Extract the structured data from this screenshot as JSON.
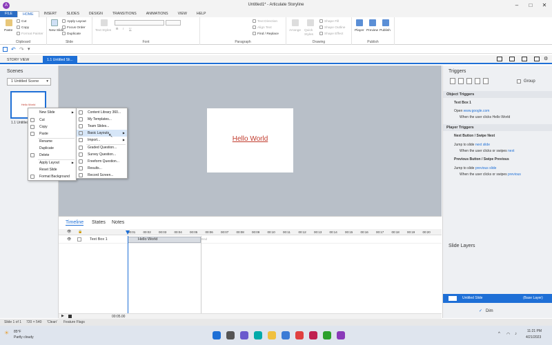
{
  "window": {
    "title": "Untitled1* - Articulate Storyline",
    "app_icon": "A"
  },
  "ribbon_tabs": [
    "FILE",
    "HOME",
    "INSERT",
    "SLIDES",
    "DESIGN",
    "TRANSITIONS",
    "ANIMATIONS",
    "VIEW",
    "HELP"
  ],
  "ribbon": {
    "clipboard": {
      "paste": "Paste",
      "cut": "Cut",
      "copy": "Copy",
      "format_painter": "Format Painter",
      "label": "Clipboard"
    },
    "slide": {
      "new_slide": "New Slide",
      "apply_layout": "Apply Layout",
      "focus_order": "Focus Order",
      "duplicate": "Duplicate",
      "label": "Slide"
    },
    "font": {
      "text_styles": "Text Styles",
      "label": "Font"
    },
    "paragraph": {
      "text_direction": "Text Direction",
      "align_text": "Align Text",
      "find_replace": "Find / Replace",
      "label": "Paragraph"
    },
    "drawing": {
      "arrange": "Arrange",
      "quick_styles": "Quick Styles",
      "shape_fill": "Shape Fill",
      "shape_outline": "Shape Outline",
      "shape_effect": "Shape Effect",
      "label": "Drawing"
    },
    "publish": {
      "player": "Player",
      "preview": "Preview",
      "publish": "Publish",
      "label": "Publish"
    }
  },
  "view_tabs": {
    "story_view": "STORY VIEW",
    "slide_tab": "1.1 Untitled Sli..."
  },
  "scenes": {
    "title": "Scenes",
    "dropdown": "1 Untitled Scene",
    "thumb_text": "Hello World",
    "thumb_label": "1.1 Untitled"
  },
  "slide": {
    "text": "Hello World"
  },
  "context_menu": {
    "items": [
      "New Slide",
      "Cut",
      "Copy",
      "Paste",
      "Rename",
      "Duplicate",
      "Delete",
      "Apply Layout",
      "Reset Slide",
      "Format Background"
    ]
  },
  "submenu": {
    "items": [
      "Content Library 360...",
      "My Templates...",
      "Team Slides...",
      "Basic Layouts",
      "Import...",
      "Graded Question...",
      "Survey Question...",
      "Freeform Question...",
      "Results...",
      "Record Screen..."
    ]
  },
  "timeline": {
    "tabs": [
      "Timeline",
      "States",
      "Notes"
    ],
    "ticks": [
      "00:01",
      "00:02",
      "00:03",
      "00:04",
      "00:05",
      "00:06",
      "00:07",
      "00:08",
      "00:09",
      "00:10",
      "00:11",
      "00:12",
      "00:13",
      "00:14",
      "00:15",
      "00:16",
      "00:17",
      "00:18",
      "00:19",
      "00:20"
    ],
    "row_label": "Text Box 1",
    "bar_text": "Hello World",
    "end_label": "End",
    "time": "00:05.00"
  },
  "triggers": {
    "title": "Triggers",
    "group_label": "Group",
    "object_triggers": "Object Triggers",
    "textbox": "Text Box 1",
    "open_prefix": "Open",
    "open_link": "www.google.com",
    "open_when": "When the user clicks Hello World",
    "player_triggers": "Player Triggers",
    "next_title": "Next Button / Swipe Next",
    "next_prefix": "Jump to slide",
    "next_link": "next slide",
    "next_when_prefix": "When the user clicks or swipes",
    "next_when_link": "next",
    "prev_title": "Previous Button / Swipe Previous",
    "prev_prefix": "Jump to slide",
    "prev_link": "previous slide",
    "prev_when_prefix": "When the user clicks or swipes",
    "prev_when_link": "previous"
  },
  "slide_layers": {
    "title": "Slide Layers",
    "layer_name": "Untitled Slide",
    "base_label": "(Base Layer)",
    "dim": "Dim"
  },
  "statusbar": {
    "slide_info": "Slide 1 of 1",
    "size": "720 × 540",
    "theme": "'Clean'",
    "feature_flags": "Feature Flags"
  },
  "taskbar": {
    "weather_temp": "85°F",
    "weather_desc": "Partly cloudy",
    "time": "11:21 PM",
    "date": "4/21/2023"
  }
}
